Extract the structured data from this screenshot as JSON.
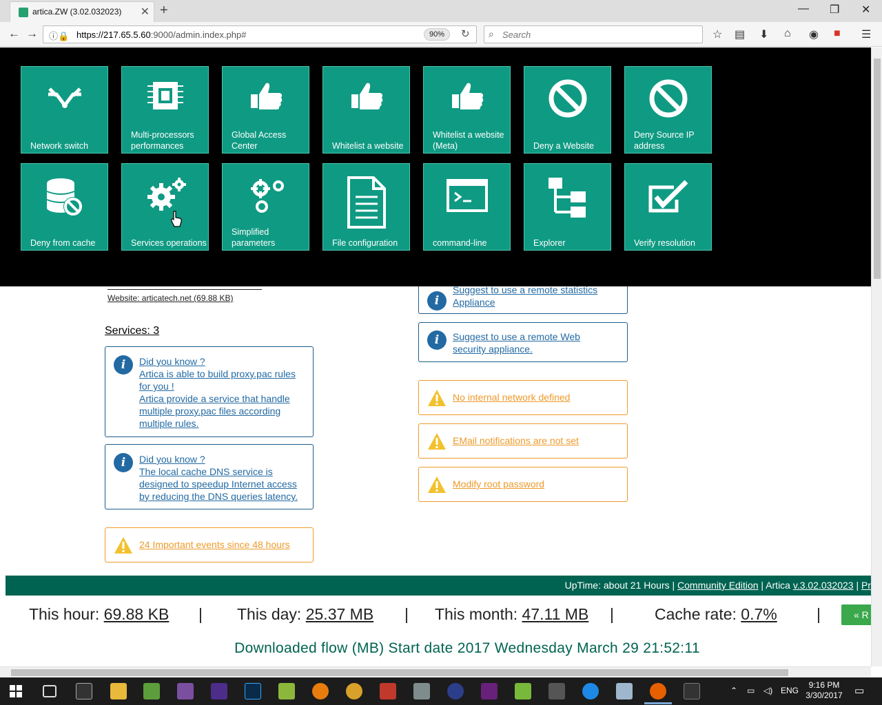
{
  "browser": {
    "tab_title": "artica.ZW (3.02.032023)",
    "url_host": "https://217.65.5.60",
    "url_rest": ":9000/admin.index.php#",
    "zoom": "90%",
    "search_placeholder": "Search"
  },
  "menu_tiles": [
    {
      "label": "Network switch",
      "icon": "network-switch-icon"
    },
    {
      "label": "Multi-processors performances",
      "icon": "cpu-icon"
    },
    {
      "label": "Global Access Center",
      "icon": "thumbs-up-icon"
    },
    {
      "label": "Whitelist a website",
      "icon": "thumbs-up-icon"
    },
    {
      "label": "Whitelist a website (Meta)",
      "icon": "thumbs-up-icon"
    },
    {
      "label": "Deny a Website",
      "icon": "forbidden-icon"
    },
    {
      "label": "Deny Source IP address",
      "icon": "forbidden-icon"
    },
    {
      "label": "Deny from cache",
      "icon": "database-deny-icon"
    },
    {
      "label": "Services operations",
      "icon": "gears-icon"
    },
    {
      "label": "Simplified parameters",
      "icon": "gears-outline-icon"
    },
    {
      "label": "File configuration",
      "icon": "document-icon"
    },
    {
      "label": "command-line",
      "icon": "terminal-icon"
    },
    {
      "label": "Explorer",
      "icon": "tree-icon"
    },
    {
      "label": "Verify resolution",
      "icon": "checkbox-icon"
    }
  ],
  "left": {
    "website_line": "Website: articatech.net (69.88 KB)",
    "services_title": "Services: 3",
    "notices": [
      {
        "lines": [
          "Did you know ?",
          "Artica is able to build proxy.pac rules",
          "for you !",
          "Artica provide a service that handle",
          "multiple proxy.pac files according",
          "multiple rules."
        ]
      },
      {
        "lines": [
          "Did you know ?",
          "The local cache DNS service is",
          "designed to speedup Internet access",
          "by reducing the DNS queries latency."
        ]
      }
    ],
    "events": "24 Important events since 48 hours"
  },
  "right": {
    "info": [
      [
        "Suggest to use a remote statistics",
        "Appliance"
      ],
      [
        "Suggest to use a remote Web",
        "security appliance."
      ]
    ],
    "warnings": [
      "No internal network defined",
      "EMail notifications are not set",
      "Modify root password"
    ]
  },
  "footer": {
    "uptime": "UpTime: about 21 Hours |",
    "edition": "Community Edition",
    "artica_prefix": "| Artica",
    "version": "v.3.02.032023",
    "tail_sep": "|",
    "tail": "Pr"
  },
  "stats": {
    "hour_label": "This hour:",
    "hour_value": "69.88 KB",
    "day_label": "This day:",
    "day_value": "25.37 MB",
    "month_label": "This month:",
    "month_value": "47.11 MB",
    "cache_label": "Cache rate:",
    "cache_value": "0.7%",
    "sep": "|",
    "button": "« R"
  },
  "flow_title": "Downloaded flow (MB) Start date 2017 Wednesday March 29 21:52:11",
  "taskbar": {
    "lang": "ENG",
    "time": "9:16 PM",
    "date": "3/30/2017"
  },
  "colors": {
    "tile": "#0f9a83",
    "footer": "#006351",
    "info": "#236aa3",
    "warning": "#ee9a2a"
  }
}
